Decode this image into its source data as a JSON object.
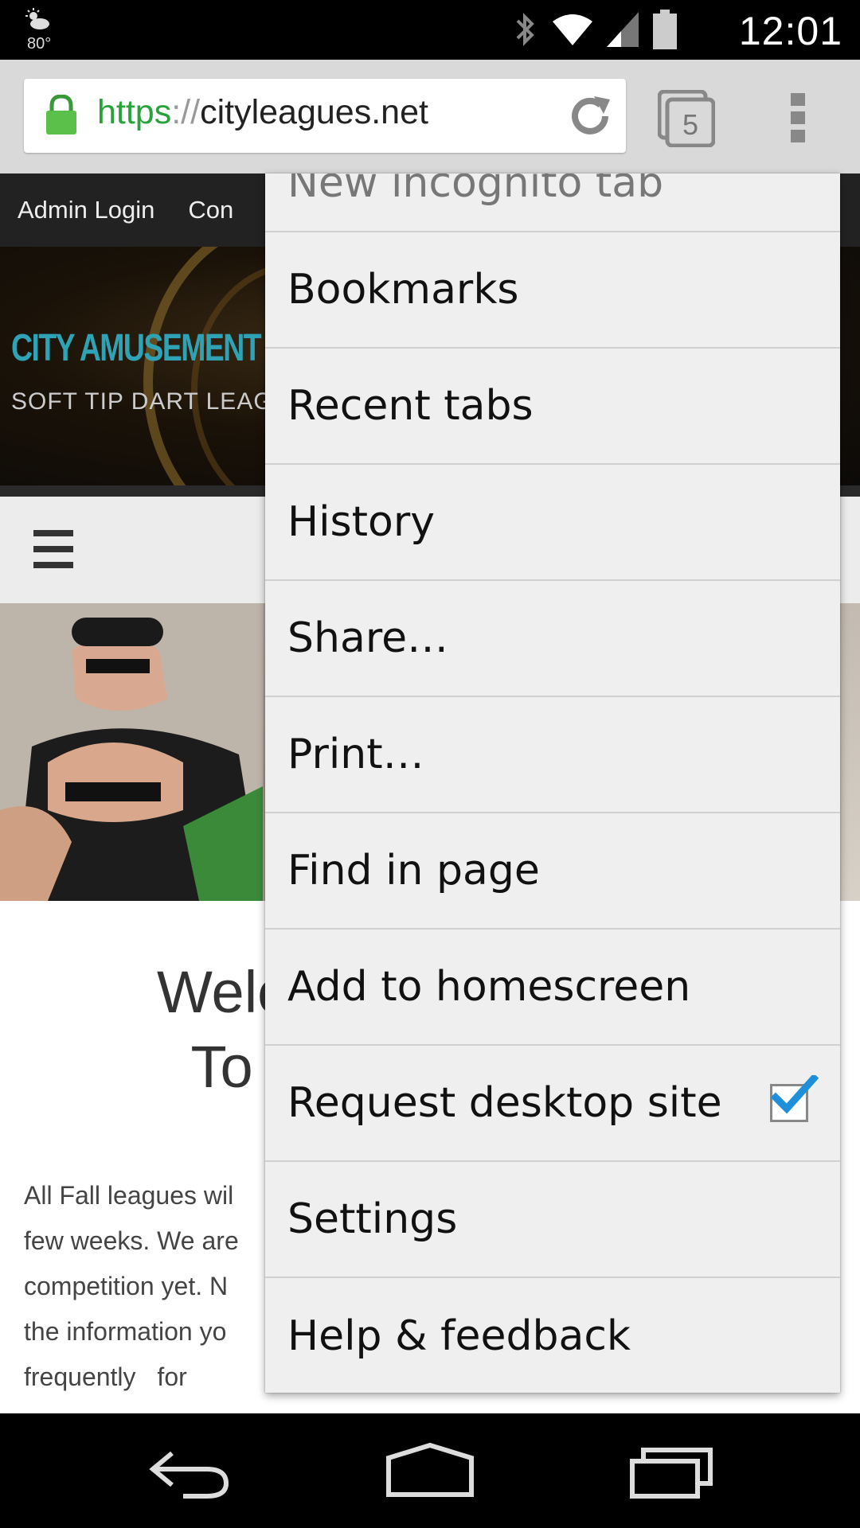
{
  "status_bar": {
    "weather_temp": "80°",
    "clock": "12:01",
    "icons": [
      "weather-icon",
      "bluetooth-icon",
      "wifi-icon",
      "cell-signal-icon",
      "battery-icon"
    ]
  },
  "toolbar": {
    "url_scheme": "https",
    "url_sep": "://",
    "url_host": "cityleagues.net",
    "tab_count": "5"
  },
  "page": {
    "nav_items": [
      "Admin Login",
      "Con"
    ],
    "site_title": "CITY AMUSEMENT LEAG",
    "site_subtitle": "SOFT TIP DART LEAG",
    "welcome_line1": "Welcom",
    "welcome_line2": "To Yo",
    "body_lines": [
      "All Fall leagues wil",
      "few weeks. We are",
      "competition yet. N",
      "the information yo",
      "frequently   for"
    ]
  },
  "menu": {
    "items": [
      {
        "label": "New incognito tab",
        "checkbox": false
      },
      {
        "label": "Bookmarks",
        "checkbox": false
      },
      {
        "label": "Recent tabs",
        "checkbox": false
      },
      {
        "label": "History",
        "checkbox": false
      },
      {
        "label": "Share…",
        "checkbox": false
      },
      {
        "label": "Print…",
        "checkbox": false
      },
      {
        "label": "Find in page",
        "checkbox": false
      },
      {
        "label": "Add to homescreen",
        "checkbox": false
      },
      {
        "label": "Request desktop site",
        "checkbox": true,
        "checked": true
      },
      {
        "label": "Settings",
        "checkbox": false
      },
      {
        "label": "Help & feedback",
        "checkbox": false
      }
    ]
  },
  "colors": {
    "url_scheme": "#2aa23b",
    "site_title": "#2fa3b5",
    "check": "#1e8fd8"
  }
}
